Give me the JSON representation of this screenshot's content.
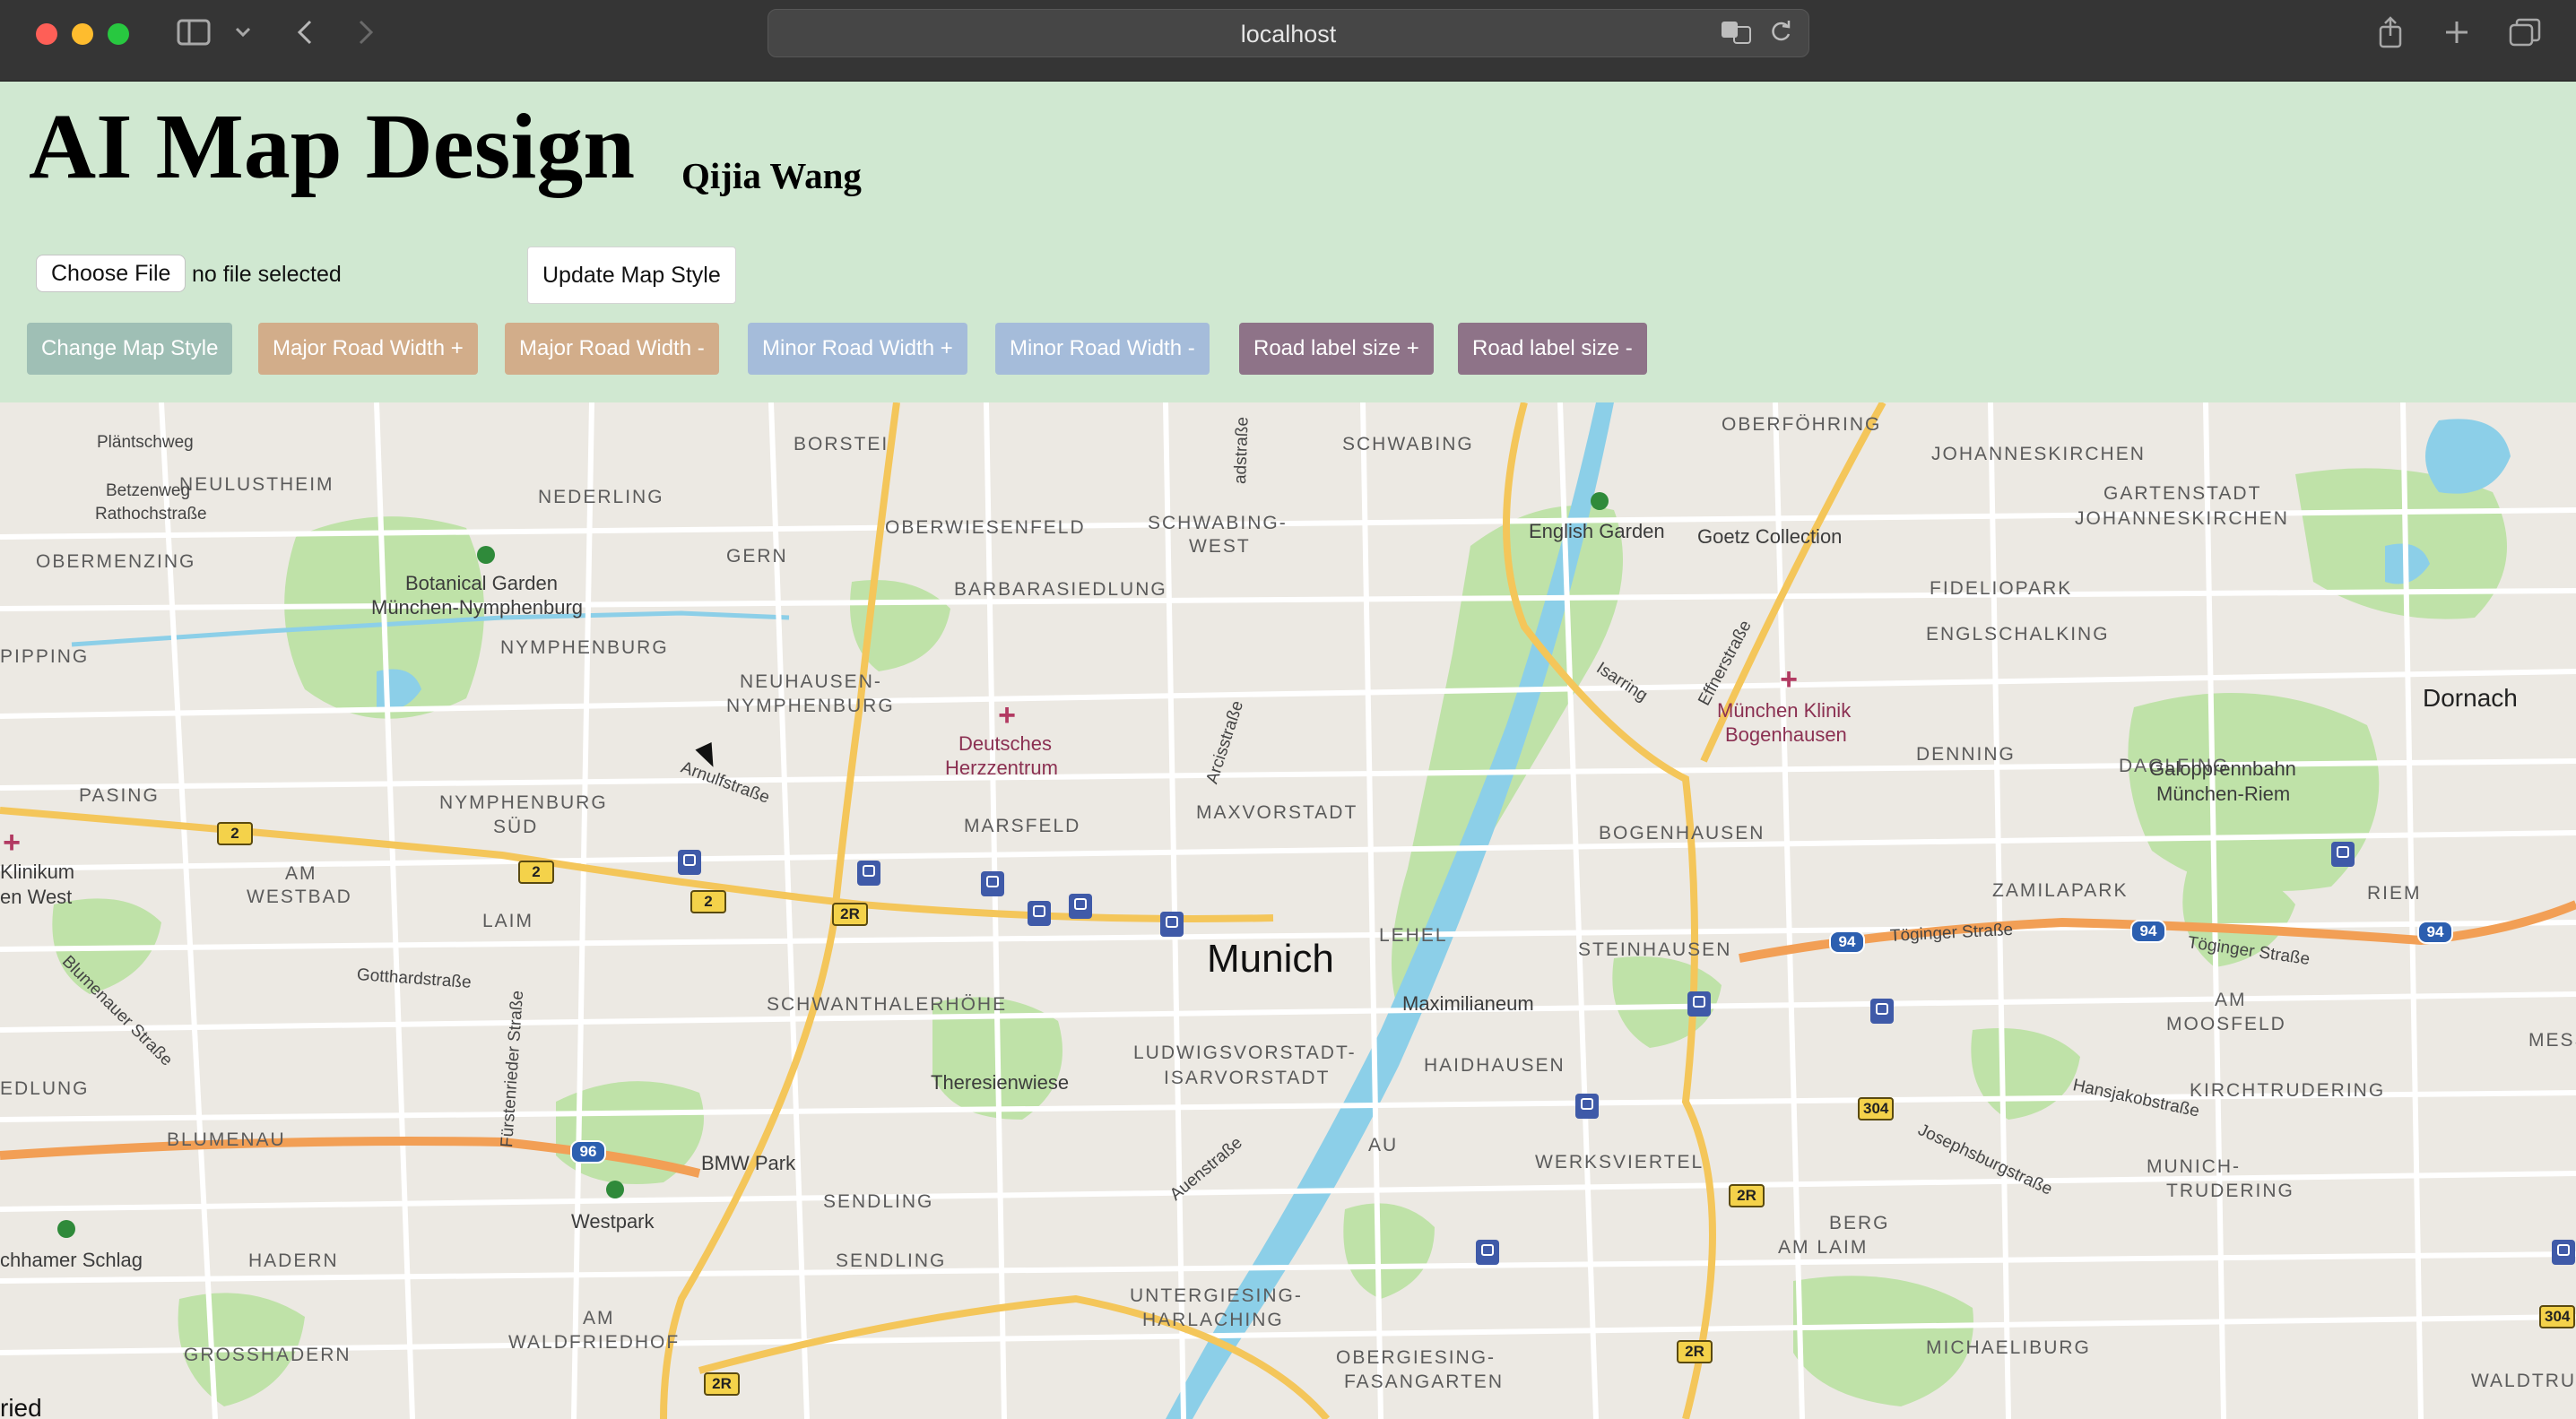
{
  "browser": {
    "url": "localhost",
    "icons": [
      "sidebar-icon",
      "chevron-down-icon",
      "back-icon",
      "forward-icon",
      "translate-icon",
      "reload-icon",
      "share-icon",
      "new-tab-icon",
      "tabs-overview-icon"
    ]
  },
  "app": {
    "title": "AI Map Design",
    "author": "Qijia Wang",
    "file_button": "Choose File",
    "file_status": "no file selected",
    "update_button": "Update Map Style"
  },
  "controls": [
    {
      "label": "Change Map Style",
      "color": "#9fbfb5"
    },
    {
      "label": "Major Road Width +",
      "color": "#d2ad8a"
    },
    {
      "label": "Major Road Width -",
      "color": "#d2ad8a"
    },
    {
      "label": "Minor Road Width +",
      "color": "#a5bcda"
    },
    {
      "label": "Minor Road Width -",
      "color": "#a5bcda"
    },
    {
      "label": "Road label size +",
      "color": "#8e7388"
    },
    {
      "label": "Road label size -",
      "color": "#8e7388"
    }
  ],
  "map": {
    "city": "Munich",
    "districts": [
      "BORSTEI",
      "SCHWABING",
      "OBERFÖHRING",
      "JOHANNESKIRCHEN",
      "GARTENSTADT",
      "JOHANNESKIRCHEN",
      "NEULUSTHEIM",
      "NEDERLING",
      "OBERWIESENFELD",
      "SCHWABING-",
      "WEST",
      "OBERMENZING",
      "GERN",
      "BARBARASIEDLUNG",
      "FIDELIOPARK",
      "ENGLSCHALKING",
      "PIPPING",
      "NYMPHENBURG",
      "NEUHAUSEN-",
      "NYMPHENBURG",
      "DENNING",
      "DAGLFING",
      "PASING",
      "NYMPHENBURG",
      "SÜD",
      "MAXVORSTADT",
      "MARSFELD",
      "BOGENHAUSEN",
      "ZAMILAPARK",
      "RIEM",
      "AM",
      "WESTBAD",
      "LAIM",
      "LEHEL",
      "STEINHAUSEN",
      "SCHWANTHALERHÖHE",
      "AM",
      "MOOSFELD",
      "MESSES",
      "EDLUNG",
      "LUDWIGSVORSTADT-",
      "ISARVORSTADT",
      "HAIDHAUSEN",
      "KIRCHTRUDERING",
      "BLUMENAU",
      "AU",
      "WERKSVIERTEL",
      "MUNICH-",
      "TRUDERING",
      "SENDLING",
      "BERG",
      "AM LAIM",
      "HADERN",
      "SENDLING",
      "AM",
      "WALDFRIEDHOF",
      "UNTERGIESING-",
      "HARLACHING",
      "GROSSHADERN",
      "OBERGIESING-",
      "FASANGARTEN",
      "MICHAELIBURG",
      "WALDTRUDERI"
    ],
    "pois": [
      "Botanical Garden",
      "München-Nymphenburg",
      "English Garden",
      "Goetz Collection",
      "Theresienwiese",
      "Maximilianeum",
      "BMW Park",
      "Westpark",
      "Galopprennbahn",
      "München-Riem",
      "chhamer Schlag",
      "Klinikum",
      "en West",
      "ried"
    ],
    "medical": [
      "Deutsches",
      "Herzzentrum",
      "München Klinik",
      "Bogenhausen"
    ],
    "towns": [
      "Dornach"
    ],
    "streets": [
      "Pläntschweg",
      "Betzenweg",
      "Rathochstraße",
      "Arnulfstraße",
      "Arcisstraße",
      "Isarring",
      "Effnerstraße",
      "Gotthardstraße",
      "Blumenauer Straße",
      "Fürstenrieder Straße",
      "Auenstraße",
      "Töginger Straße",
      "Töginger Straße",
      "Hansjakobstraße",
      "Josephsburgstraße",
      "adstraße"
    ],
    "shields": [
      "2",
      "2",
      "2",
      "2R",
      "2R",
      "2R",
      "2R",
      "96",
      "94",
      "94",
      "94",
      "304",
      "304"
    ]
  }
}
